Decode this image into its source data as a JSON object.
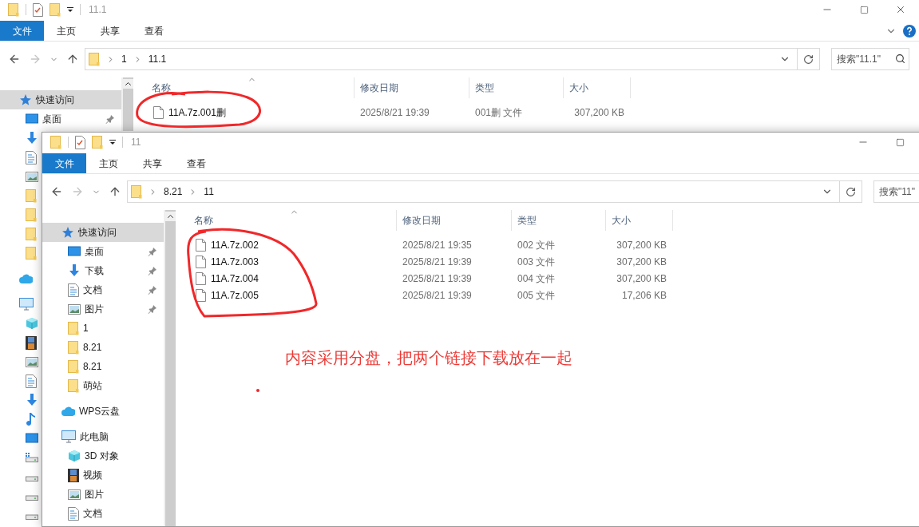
{
  "windows": [
    {
      "title": "11.1",
      "controls": [
        {
          "kind": "minimize"
        },
        {
          "kind": "maximize"
        },
        {
          "kind": "close"
        }
      ],
      "ribbon_buttons": [
        {
          "kind": "collapse"
        },
        {
          "kind": "help"
        }
      ],
      "forward_disabled": true,
      "ribbon_tabs": [
        {
          "label": "文件",
          "kind": "file-menu"
        },
        {
          "label": "主页",
          "kind": "tab"
        },
        {
          "label": "共享",
          "kind": "tab"
        },
        {
          "label": "查看",
          "kind": "tab"
        }
      ],
      "path": [
        "1",
        "11.1"
      ],
      "search": {
        "placeholder": "搜索\"11.1\""
      },
      "nav": [
        {
          "kind": "quick-access",
          "label": "快速访问",
          "selected": true,
          "children": [
            {
              "kind": "desktop",
              "label": "桌面",
              "pinned": true,
              "selected": false
            },
            {
              "kind": "downloads",
              "selected": false
            },
            {
              "kind": "documents",
              "selected": false
            },
            {
              "kind": "pictures",
              "selected": false
            },
            {
              "kind": "folder",
              "selected": false
            },
            {
              "kind": "folder",
              "selected": false
            },
            {
              "kind": "folder",
              "selected": false
            },
            {
              "kind": "folder",
              "selected": false
            }
          ]
        },
        {
          "kind": "cloud",
          "selected": false
        },
        {
          "kind": "pc",
          "selected": false,
          "children": [
            {
              "kind": "objects3d",
              "selected": false
            },
            {
              "kind": "videos",
              "selected": false
            },
            {
              "kind": "pictures",
              "selected": false
            },
            {
              "kind": "documents",
              "selected": false
            },
            {
              "kind": "downloads",
              "selected": false
            },
            {
              "kind": "music",
              "selected": false
            },
            {
              "kind": "desktop",
              "selected": false
            },
            {
              "kind": "system-drive",
              "selected": false
            },
            {
              "kind": "drive",
              "selected": false
            },
            {
              "kind": "drive",
              "selected": false
            },
            {
              "kind": "drive",
              "selected": false
            }
          ]
        }
      ],
      "columns": [
        "名称",
        "修改日期",
        "类型",
        "大小"
      ],
      "files": [
        {
          "name": "11A.7z.001删",
          "modified": "2025/8/21 19:39",
          "type": "001删 文件",
          "size": "307,200 KB"
        }
      ]
    },
    {
      "title": "11",
      "controls": [
        {
          "kind": "minimize"
        },
        {
          "kind": "maximize"
        }
      ],
      "forward_disabled": true,
      "ribbon_tabs": [
        {
          "label": "文件",
          "kind": "file-menu"
        },
        {
          "label": "主页",
          "kind": "tab"
        },
        {
          "label": "共享",
          "kind": "tab"
        },
        {
          "label": "查看",
          "kind": "tab"
        }
      ],
      "path": [
        "8.21",
        "11"
      ],
      "search": {
        "placeholder": "搜索\"11\""
      },
      "nav": [
        {
          "kind": "quick-access",
          "label": "快速访问",
          "selected": true,
          "children": [
            {
              "kind": "desktop",
              "label": "桌面",
              "pinned": true,
              "selected": false
            },
            {
              "kind": "downloads",
              "label": "下载",
              "pinned": true,
              "selected": false
            },
            {
              "kind": "documents",
              "label": "文档",
              "pinned": true,
              "selected": false
            },
            {
              "kind": "pictures",
              "label": "图片",
              "pinned": true,
              "selected": false
            },
            {
              "kind": "folder",
              "label": "1",
              "pinned": false,
              "selected": false
            },
            {
              "kind": "folder",
              "label": "8.21",
              "pinned": false,
              "selected": false
            },
            {
              "kind": "folder",
              "label": "8.21",
              "pinned": false,
              "selected": false
            },
            {
              "kind": "folder",
              "label": "萌站",
              "pinned": false,
              "selected": false
            }
          ]
        },
        {
          "kind": "cloud",
          "label": "WPS云盘",
          "selected": false
        },
        {
          "kind": "pc",
          "label": "此电脑",
          "selected": false,
          "children": [
            {
              "kind": "objects3d",
              "label": "3D 对象",
              "selected": false
            },
            {
              "kind": "videos",
              "label": "视频",
              "selected": false
            },
            {
              "kind": "pictures",
              "label": "图片",
              "selected": false
            },
            {
              "kind": "documents",
              "label": "文档",
              "selected": false
            }
          ]
        }
      ],
      "columns": [
        "名称",
        "修改日期",
        "类型",
        "大小"
      ],
      "files": [
        {
          "name": "11A.7z.002",
          "modified": "2025/8/21 19:35",
          "type": "002 文件",
          "size": "307,200 KB"
        },
        {
          "name": "11A.7z.003",
          "modified": "2025/8/21 19:39",
          "type": "003 文件",
          "size": "307,200 KB"
        },
        {
          "name": "11A.7z.004",
          "modified": "2025/8/21 19:39",
          "type": "004 文件",
          "size": "307,200 KB"
        },
        {
          "name": "11A.7z.005",
          "modified": "2025/8/21 19:39",
          "type": "005 文件",
          "size": "17,206 KB"
        }
      ]
    }
  ],
  "annotation": {
    "text": "内容采用分盘，把两个链接下载放在一起"
  }
}
